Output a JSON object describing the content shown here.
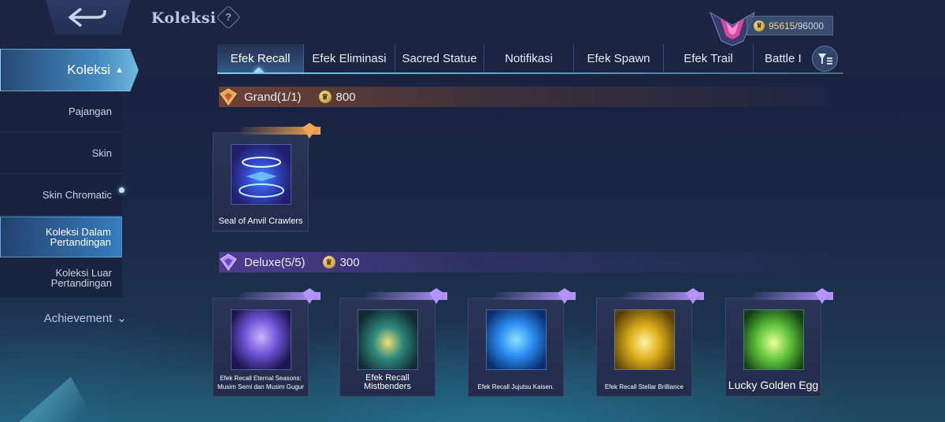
{
  "header": {
    "title": "Koleksi",
    "help_symbol": "?",
    "points_current": "95615",
    "points_separator": "/",
    "points_max": "96000",
    "coin_symbol": "♛"
  },
  "sidebar": {
    "active": {
      "label": "Koleksi",
      "caret": "▲"
    },
    "items": [
      {
        "label": "Pajangan"
      },
      {
        "label": "Skin"
      },
      {
        "label": "Skin Chromatic"
      },
      {
        "label": "Koleksi Dalam Pertandingan"
      },
      {
        "label": "Koleksi Luar Pertandingan"
      }
    ],
    "achievement": {
      "label": "Achievement",
      "caret": "⌄"
    }
  },
  "tabs": [
    {
      "label": "Efek Recall"
    },
    {
      "label": "Efek Eliminasi"
    },
    {
      "label": "Sacred Statue"
    },
    {
      "label": "Notifikasi"
    },
    {
      "label": "Efek Spawn"
    },
    {
      "label": "Efek Trail"
    },
    {
      "label": "Battle I"
    }
  ],
  "sections": {
    "grand": {
      "label": "Grand(1/1)",
      "price": "800",
      "items": [
        {
          "name": "Seal of Anvil Crawlers"
        }
      ]
    },
    "deluxe": {
      "label": "Deluxe(5/5)",
      "price": "300",
      "items": [
        {
          "name": "Efek Recall Eternal Seasons: Musim Semi dan Musim Gugur"
        },
        {
          "name": "Efek Recall Mistbenders"
        },
        {
          "name": "Efek Recall Jujutsu Kaisen."
        },
        {
          "name": "Efek Recall Stellar Brilliance"
        },
        {
          "name": "Lucky Golden Egg"
        }
      ]
    }
  },
  "colors": {
    "accent": "#7fcaf4",
    "grand": "#f0a552",
    "deluxe": "#b494ff",
    "gold": "#f1d67a"
  }
}
